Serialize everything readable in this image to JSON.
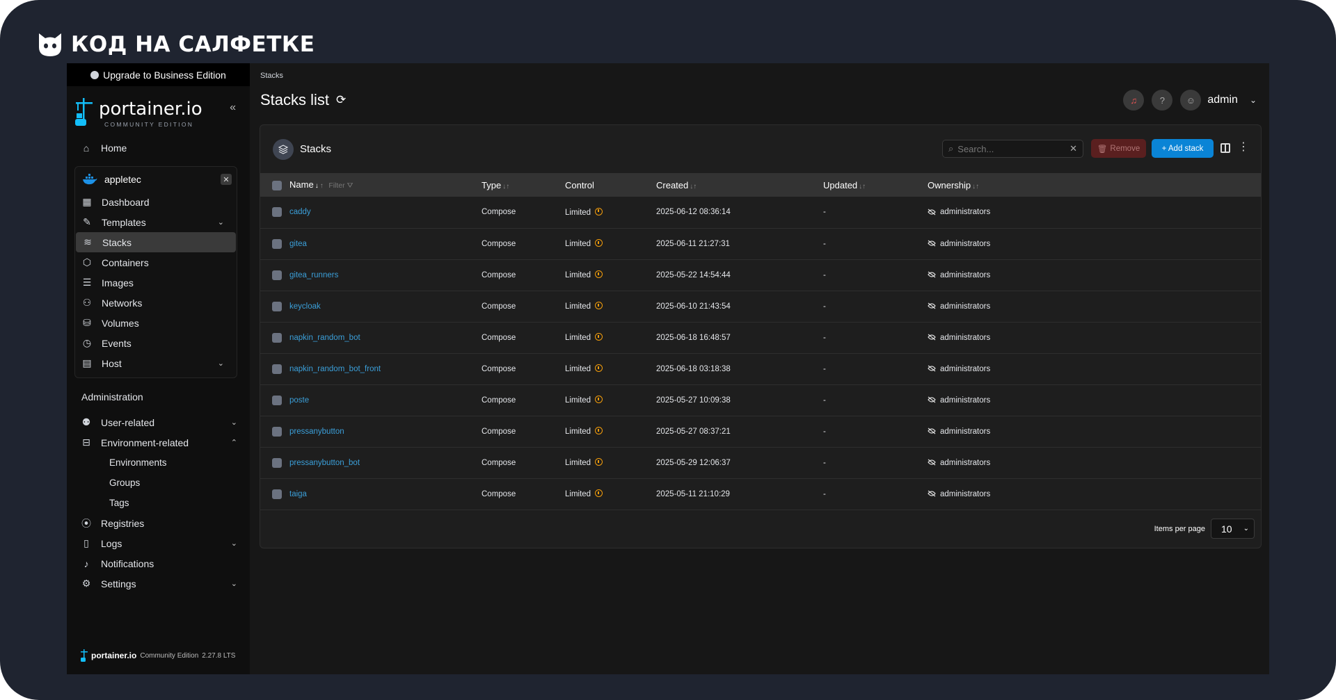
{
  "brand": {
    "title": "КОД НА САЛФЕТКЕ"
  },
  "upgrade": {
    "label": "Upgrade to Business Edition"
  },
  "logo": {
    "word": "portainer.io",
    "sub": "COMMUNITY EDITION"
  },
  "sidebar": {
    "home": "Home",
    "environment": {
      "name": "appletec",
      "items": [
        {
          "label": "Dashboard",
          "icon": "dashboard-icon",
          "chevron": false
        },
        {
          "label": "Templates",
          "icon": "edit-icon",
          "chevron": true
        },
        {
          "label": "Stacks",
          "icon": "stacks-icon",
          "chevron": false,
          "active": true
        },
        {
          "label": "Containers",
          "icon": "cube-icon",
          "chevron": false
        },
        {
          "label": "Images",
          "icon": "list-icon",
          "chevron": false
        },
        {
          "label": "Networks",
          "icon": "network-icon",
          "chevron": false
        },
        {
          "label": "Volumes",
          "icon": "database-icon",
          "chevron": false
        },
        {
          "label": "Events",
          "icon": "clock-icon",
          "chevron": false
        },
        {
          "label": "Host",
          "icon": "host-icon",
          "chevron": true
        }
      ]
    },
    "administration": "Administration",
    "admin_items": {
      "user_related": "User-related",
      "environment_related": "Environment-related",
      "environments": "Environments",
      "groups": "Groups",
      "tags": "Tags",
      "registries": "Registries",
      "logs": "Logs",
      "notifications": "Notifications",
      "settings": "Settings"
    },
    "footer": {
      "brand": "portainer.io",
      "edition": "Community Edition",
      "version": "2.27.8 LTS"
    }
  },
  "main": {
    "breadcrumb": "Stacks",
    "title": "Stacks list",
    "user": "admin",
    "card_title": "Stacks",
    "search_placeholder": "Search...",
    "remove_label": "Remove",
    "add_label": "+ Add stack",
    "columns": {
      "name": "Name",
      "filter": "Filter",
      "type": "Type",
      "control": "Control",
      "created": "Created",
      "updated": "Updated",
      "ownership": "Ownership"
    },
    "rows": [
      {
        "name": "caddy",
        "type": "Compose",
        "control": "Limited",
        "created": "2025-06-12 08:36:14",
        "updated": "-",
        "ownership": "administrators"
      },
      {
        "name": "gitea",
        "type": "Compose",
        "control": "Limited",
        "created": "2025-06-11 21:27:31",
        "updated": "-",
        "ownership": "administrators"
      },
      {
        "name": "gitea_runners",
        "type": "Compose",
        "control": "Limited",
        "created": "2025-05-22 14:54:44",
        "updated": "-",
        "ownership": "administrators"
      },
      {
        "name": "keycloak",
        "type": "Compose",
        "control": "Limited",
        "created": "2025-06-10 21:43:54",
        "updated": "-",
        "ownership": "administrators"
      },
      {
        "name": "napkin_random_bot",
        "type": "Compose",
        "control": "Limited",
        "created": "2025-06-18 16:48:57",
        "updated": "-",
        "ownership": "administrators"
      },
      {
        "name": "napkin_random_bot_front",
        "type": "Compose",
        "control": "Limited",
        "created": "2025-06-18 03:18:38",
        "updated": "-",
        "ownership": "administrators"
      },
      {
        "name": "poste",
        "type": "Compose",
        "control": "Limited",
        "created": "2025-05-27 10:09:38",
        "updated": "-",
        "ownership": "administrators"
      },
      {
        "name": "pressanybutton",
        "type": "Compose",
        "control": "Limited",
        "created": "2025-05-27 08:37:21",
        "updated": "-",
        "ownership": "administrators"
      },
      {
        "name": "pressanybutton_bot",
        "type": "Compose",
        "control": "Limited",
        "created": "2025-05-29 12:06:37",
        "updated": "-",
        "ownership": "administrators"
      },
      {
        "name": "taiga",
        "type": "Compose",
        "control": "Limited",
        "created": "2025-05-11 21:10:29",
        "updated": "-",
        "ownership": "administrators"
      }
    ],
    "items_per_page_label": "Items per page",
    "items_per_page": "10"
  },
  "colors": {
    "accent": "#0a84d6",
    "link": "#3b9fd9",
    "warning": "#f59e0b",
    "danger": "#5a1f1f"
  }
}
